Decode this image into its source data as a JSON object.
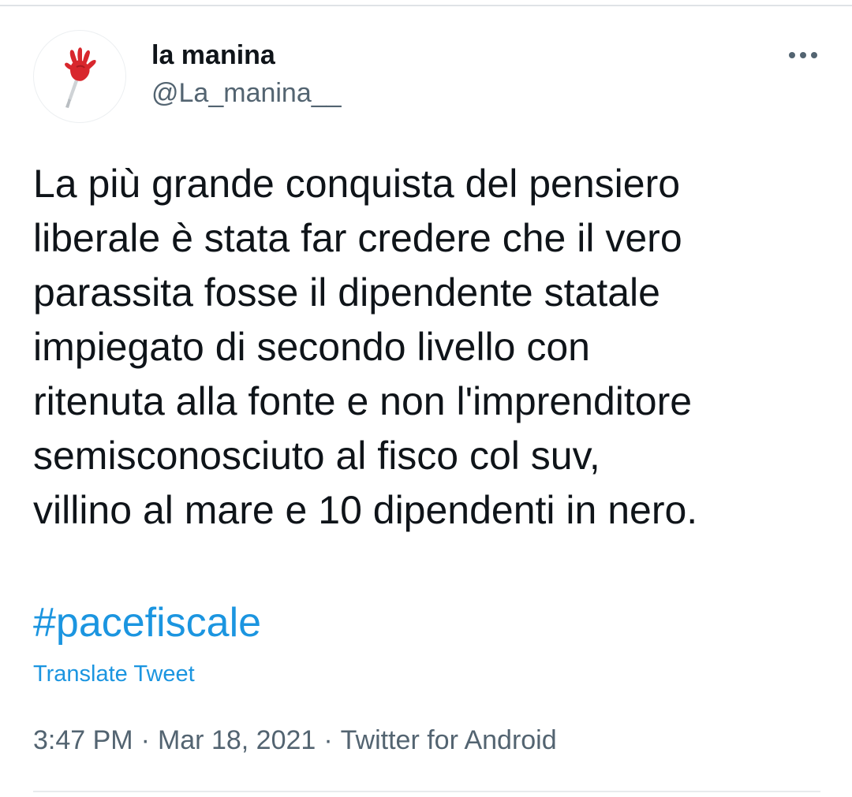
{
  "tweet": {
    "author": {
      "display_name": "la manina",
      "handle": "@La_manina__",
      "avatar_icon": "red-hand-clapper-icon"
    },
    "more_icon": "more-horizontal-icon",
    "text_lines": [
      "La più grande conquista del pensiero",
      "liberale è stata far credere che il vero",
      "parassita fosse il dipendente statale",
      "impiegato di secondo livello con",
      "ritenuta alla fonte e non l'imprenditore",
      "semisconosciuto al fisco col suv,",
      "villino al mare e 10 dipendenti in nero."
    ],
    "hashtag": "#pacefiscale",
    "translate_label": "Translate Tweet",
    "time": "3:47 PM",
    "separator": "·",
    "date": "Mar 18, 2021",
    "source": "Twitter for Android"
  },
  "colors": {
    "text": "#0f1419",
    "secondary": "#536471",
    "link": "#1b95e0",
    "divider": "#dfe3e6",
    "avatar_hand": "#d8272d"
  }
}
